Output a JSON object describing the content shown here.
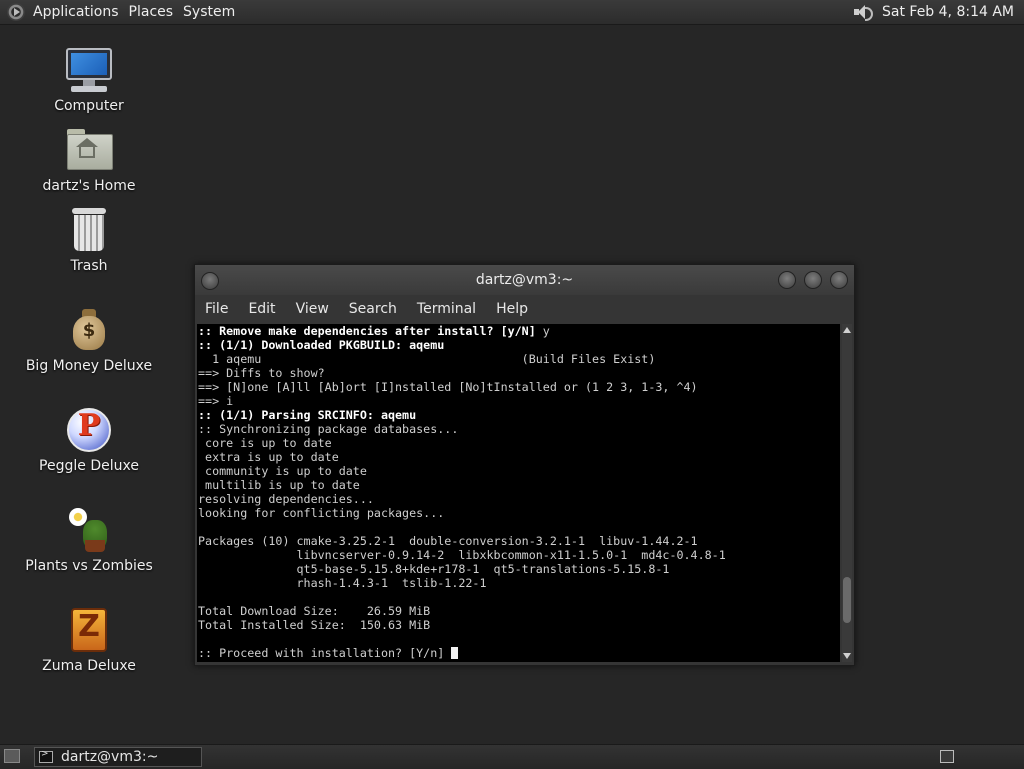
{
  "top_panel": {
    "menus": [
      "Applications",
      "Places",
      "System"
    ],
    "icons": [
      "distro-logo-icon",
      "volume-icon"
    ],
    "clock": "Sat Feb  4,  8:14 AM"
  },
  "desktop_icons": [
    {
      "label": "Computer",
      "icon": "computer-icon"
    },
    {
      "label": "dartz's Home",
      "icon": "home-folder-icon"
    },
    {
      "label": "Trash",
      "icon": "trash-icon"
    },
    {
      "label": "Big Money Deluxe",
      "icon": "money-bag-icon"
    },
    {
      "label": "Peggle Deluxe",
      "icon": "peggle-icon"
    },
    {
      "label": "Plants vs Zombies",
      "icon": "plants-vs-zombies-icon"
    },
    {
      "label": "Zuma Deluxe",
      "icon": "zuma-icon"
    }
  ],
  "terminal": {
    "title": "dartz@vm3:~",
    "menu": [
      "File",
      "Edit",
      "View",
      "Search",
      "Terminal",
      "Help"
    ],
    "lines": [
      {
        "text": ":: Remove make dependencies after install? [y/N] ",
        "bold": true,
        "tail": "y"
      },
      {
        "text": ":: (1/1) Downloaded PKGBUILD: aqemu",
        "bold": true
      },
      {
        "text": "  1 aqemu                                     (Build Files Exist)"
      },
      {
        "text": "==> Diffs to show?"
      },
      {
        "text": "==> [N]one [A]ll [Ab]ort [I]nstalled [No]tInstalled or (1 2 3, 1-3, ^4)"
      },
      {
        "text": "==> i"
      },
      {
        "text": ":: (1/1) Parsing SRCINFO: aqemu",
        "bold": true
      },
      {
        "text": ":: Synchronizing package databases..."
      },
      {
        "text": " core is up to date"
      },
      {
        "text": " extra is up to date"
      },
      {
        "text": " community is up to date"
      },
      {
        "text": " multilib is up to date"
      },
      {
        "text": "resolving dependencies..."
      },
      {
        "text": "looking for conflicting packages..."
      },
      {
        "text": ""
      },
      {
        "text": "Packages (10) cmake-3.25.2-1  double-conversion-3.2.1-1  libuv-1.44.2-1"
      },
      {
        "text": "              libvncserver-0.9.14-2  libxkbcommon-x11-1.5.0-1  md4c-0.4.8-1"
      },
      {
        "text": "              qt5-base-5.15.8+kde+r178-1  qt5-translations-5.15.8-1"
      },
      {
        "text": "              rhash-1.4.3-1  tslib-1.22-1"
      },
      {
        "text": ""
      },
      {
        "text": "Total Download Size:    26.59 MiB"
      },
      {
        "text": "Total Installed Size:  150.63 MiB"
      },
      {
        "text": ""
      },
      {
        "text": ":: Proceed with installation? [Y/n] ",
        "cursor": true
      }
    ],
    "scroll_position": 0.9
  },
  "bottom_panel": {
    "task_label": "dartz@vm3:~",
    "icons": [
      "show-desktop-icon",
      "terminal-icon",
      "workspace-switcher-icon"
    ]
  }
}
